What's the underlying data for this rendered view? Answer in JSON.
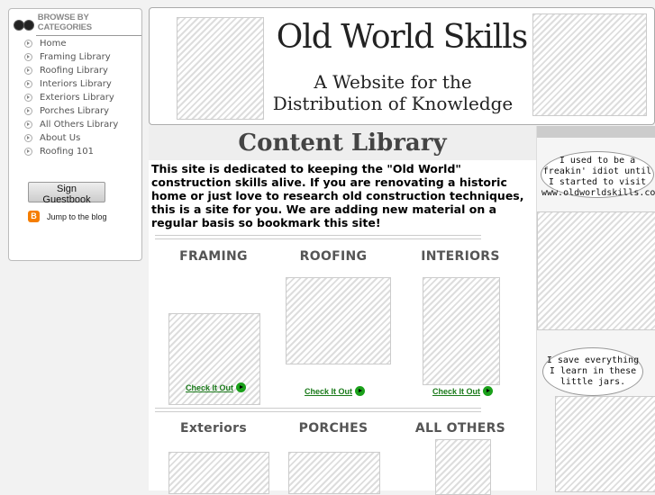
{
  "sidebar": {
    "title": "BROWSE BY CATEGORIES",
    "items": [
      "Home",
      "Framing Library",
      "Roofing Library",
      "Interiors Library",
      "Exteriors Library",
      "Porches Library",
      "All Others Library",
      "About Us",
      "Roofing 101"
    ],
    "guestbook": "Sign Guestbook",
    "blog": "Jump to the blog"
  },
  "header": {
    "title": "Old World Skills",
    "subtitle_1": "A Website for the",
    "subtitle_2": "Distribution of Knowledge"
  },
  "main": {
    "title": "Content Library",
    "intro": "This site is dedicated to keeping the \"Old World\" construction skills alive. If you are renovating a historic home or just love to research old construction techniques, this is a site for you. We are adding new material on a regular basis so bookmark this site!",
    "check": "Check It Out",
    "categories": [
      "FRAMING",
      "ROOFING",
      "INTERIORS",
      "Exteriors",
      "PORCHES",
      "ALL OTHERS"
    ]
  },
  "right": {
    "bubble1": "I used to be a freakin' idiot until I started to visit www.oldworldskills.com",
    "bubble2": "I save everything I learn in these little jars."
  }
}
